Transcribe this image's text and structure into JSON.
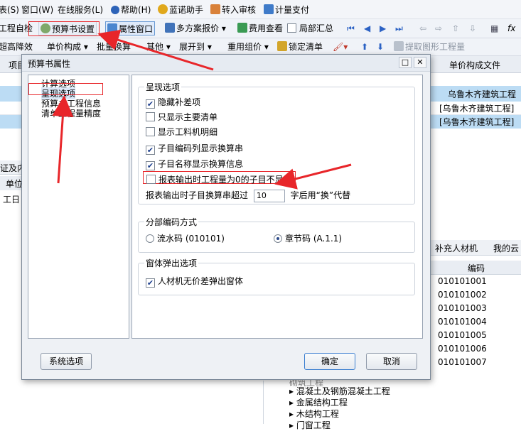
{
  "menu": [
    "表(S)",
    "窗口(W)",
    "在线服务(L)",
    "帮助(H)",
    "蓝诺助手",
    "转入审核",
    "计量支付"
  ],
  "toolbar1": {
    "items": [
      "工程自检",
      "预算书设置",
      "属性窗口",
      "多方案报价",
      "费用查看",
      "局部汇总"
    ]
  },
  "toolbar2": {
    "items": [
      "超高降效",
      "单价构成",
      "批量换算",
      "其他",
      "展开到",
      "重用组价",
      "锁定清单",
      "提取图形工程量"
    ]
  },
  "grid": {
    "header_left": "项目",
    "header_right": "单价构成文件",
    "rows": [
      "乌鲁木齐建筑工程",
      "[乌鲁木齐建筑工程]",
      "[乌鲁木齐建筑工程]"
    ]
  },
  "left_pane": {
    "header": "证及内",
    "col": "单位",
    "cell": "工日"
  },
  "right_pane": {
    "tabs": [
      "补充人材机",
      "我的云"
    ],
    "column": "编码",
    "codes": [
      "010101001",
      "010101002",
      "010101003",
      "010101004",
      "010101005",
      "010101006",
      "010101007"
    ],
    "tree": [
      "砌筑工程",
      "混凝土及钢筋混凝土工程",
      "金属结构工程",
      "木结构工程",
      "门窗工程"
    ]
  },
  "dialog": {
    "title": "预算书属性",
    "tree": [
      "计算选项",
      "呈现选项",
      "预算书工程信息",
      "清单工程量精度"
    ],
    "groups": {
      "display": {
        "title": "呈现选项",
        "options": [
          {
            "label": "隐藏补差项",
            "checked": "✔"
          },
          {
            "label": "只显示主要清单",
            "checked": ""
          },
          {
            "label": "显示工料机明细",
            "checked": ""
          },
          {
            "label": "子目编码列显示换算串",
            "checked": "✔"
          },
          {
            "label": "子目名称显示换算信息",
            "checked": "✔"
          },
          {
            "label": "报表输出时工程量为0的子目不显示",
            "checked": ""
          }
        ],
        "truncate_prefix": "报表输出时子目换算串超过",
        "truncate_value": "10",
        "truncate_suffix": "字后用“换”代替"
      },
      "coding": {
        "title": "分部编码方式",
        "opt1": "流水码 (010101)",
        "opt2": "章节码 (A.1.1)",
        "selected": "opt2"
      },
      "popup": {
        "title": "窗体弹出选项",
        "option": "人材机无价差弹出窗体",
        "checked": "✔"
      }
    },
    "buttons": {
      "system": "系统选项",
      "ok": "确定",
      "cancel": "取消"
    }
  },
  "colors": {
    "highlight": "#bcdcf4",
    "annotation": "#e8262a",
    "accent": "#3c7fd0"
  }
}
